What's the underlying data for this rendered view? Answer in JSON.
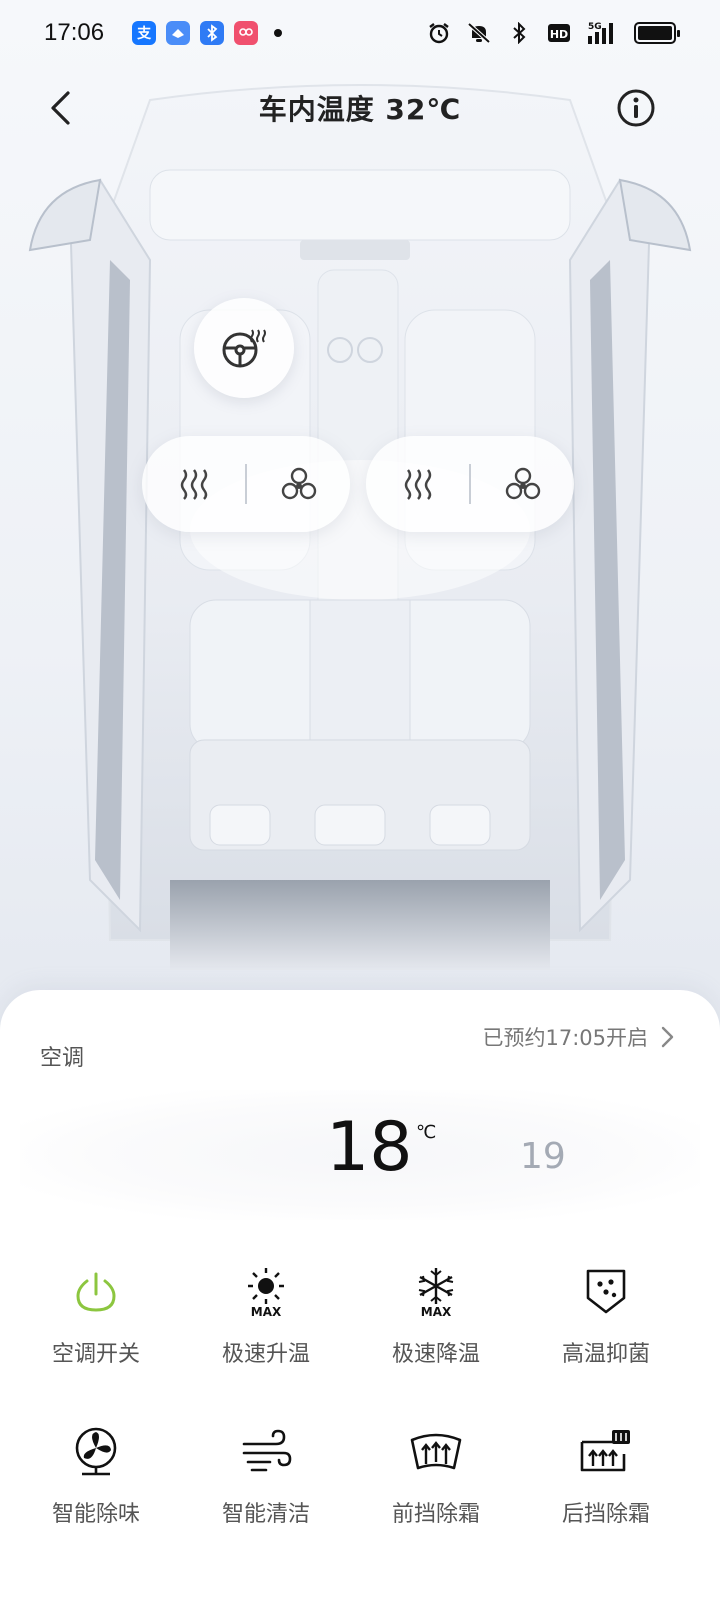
{
  "status_bar": {
    "time": "17:06",
    "apps": [
      {
        "name": "alipay-icon",
        "glyph": "支",
        "color": "#1677ff"
      },
      {
        "name": "app-icon-2",
        "glyph": "◆",
        "color": "#3f86f7"
      },
      {
        "name": "bluetooth-app-icon",
        "glyph": "✱",
        "color": "#2f7bf5"
      },
      {
        "name": "app-icon-4",
        "glyph": "◎",
        "color": "#f0506e"
      }
    ],
    "network": "5G",
    "hd": "HD"
  },
  "header": {
    "title": "车内温度 32℃"
  },
  "panel": {
    "label": "空调",
    "schedule": "已预约17:05开启",
    "temperature": {
      "current": "18",
      "unit": "℃",
      "next": "19"
    },
    "controls": [
      {
        "label": "空调开关",
        "icon": "power-icon"
      },
      {
        "label": "极速升温",
        "icon": "sun-max-icon"
      },
      {
        "label": "极速降温",
        "icon": "snow-max-icon"
      },
      {
        "label": "高温抑菌",
        "icon": "shield-dots-icon"
      },
      {
        "label": "智能除味",
        "icon": "fan-icon"
      },
      {
        "label": "智能清洁",
        "icon": "wind-icon"
      },
      {
        "label": "前挡除霜",
        "icon": "front-defrost-icon"
      },
      {
        "label": "后挡除霜",
        "icon": "rear-defrost-icon"
      }
    ],
    "max_label": "MAX"
  },
  "colors": {
    "accent_green": "#8cc63f",
    "text_dark": "#222222",
    "text_gray": "#555555"
  }
}
